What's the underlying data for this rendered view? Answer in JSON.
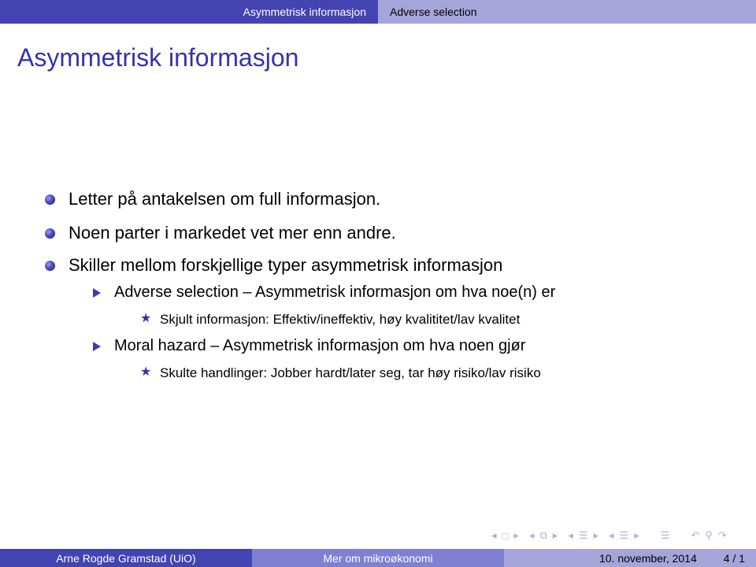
{
  "header": {
    "section_active": "Asymmetrisk informasjon",
    "section_next": "Adverse selection"
  },
  "frame_title": "Asymmetrisk informasjon",
  "bullets": [
    {
      "text": "Letter på antakelsen om full informasjon."
    },
    {
      "text": "Noen parter i markedet vet mer enn andre."
    },
    {
      "text": "Skiller mellom forskjellige typer asymmetrisk informasjon",
      "sub": [
        {
          "text": "Adverse selection – Asymmetrisk informasjon om hva noe(n) er",
          "sub": [
            {
              "text": "Skjult informasjon: Effektiv/ineffektiv, høy kvalititet/lav kvalitet"
            }
          ]
        },
        {
          "text": "Moral hazard – Asymmetrisk informasjon om hva noen gjør",
          "sub": [
            {
              "text": "Skulte handlinger: Jobber hardt/later seg, tar høy risiko/lav risiko"
            }
          ]
        }
      ]
    }
  ],
  "nav": {
    "icons": [
      "prev-frame",
      "frame",
      "next-frame",
      "prev-subsection",
      "subsection",
      "next-subsection",
      "prev-section",
      "section",
      "next-section",
      "prev-doc",
      "doc",
      "next-doc",
      "align",
      "back",
      "search",
      "forward"
    ]
  },
  "footer": {
    "author": "Arne Rogde Gramstad  (UiO)",
    "title": "Mer om mikroøkonomi",
    "date": "10. november, 2014",
    "page": "4 / 1"
  },
  "colors": {
    "dark": "#4343b2",
    "mid": "#8080d2",
    "light": "#a5a5dc",
    "title": "#3333b2"
  }
}
